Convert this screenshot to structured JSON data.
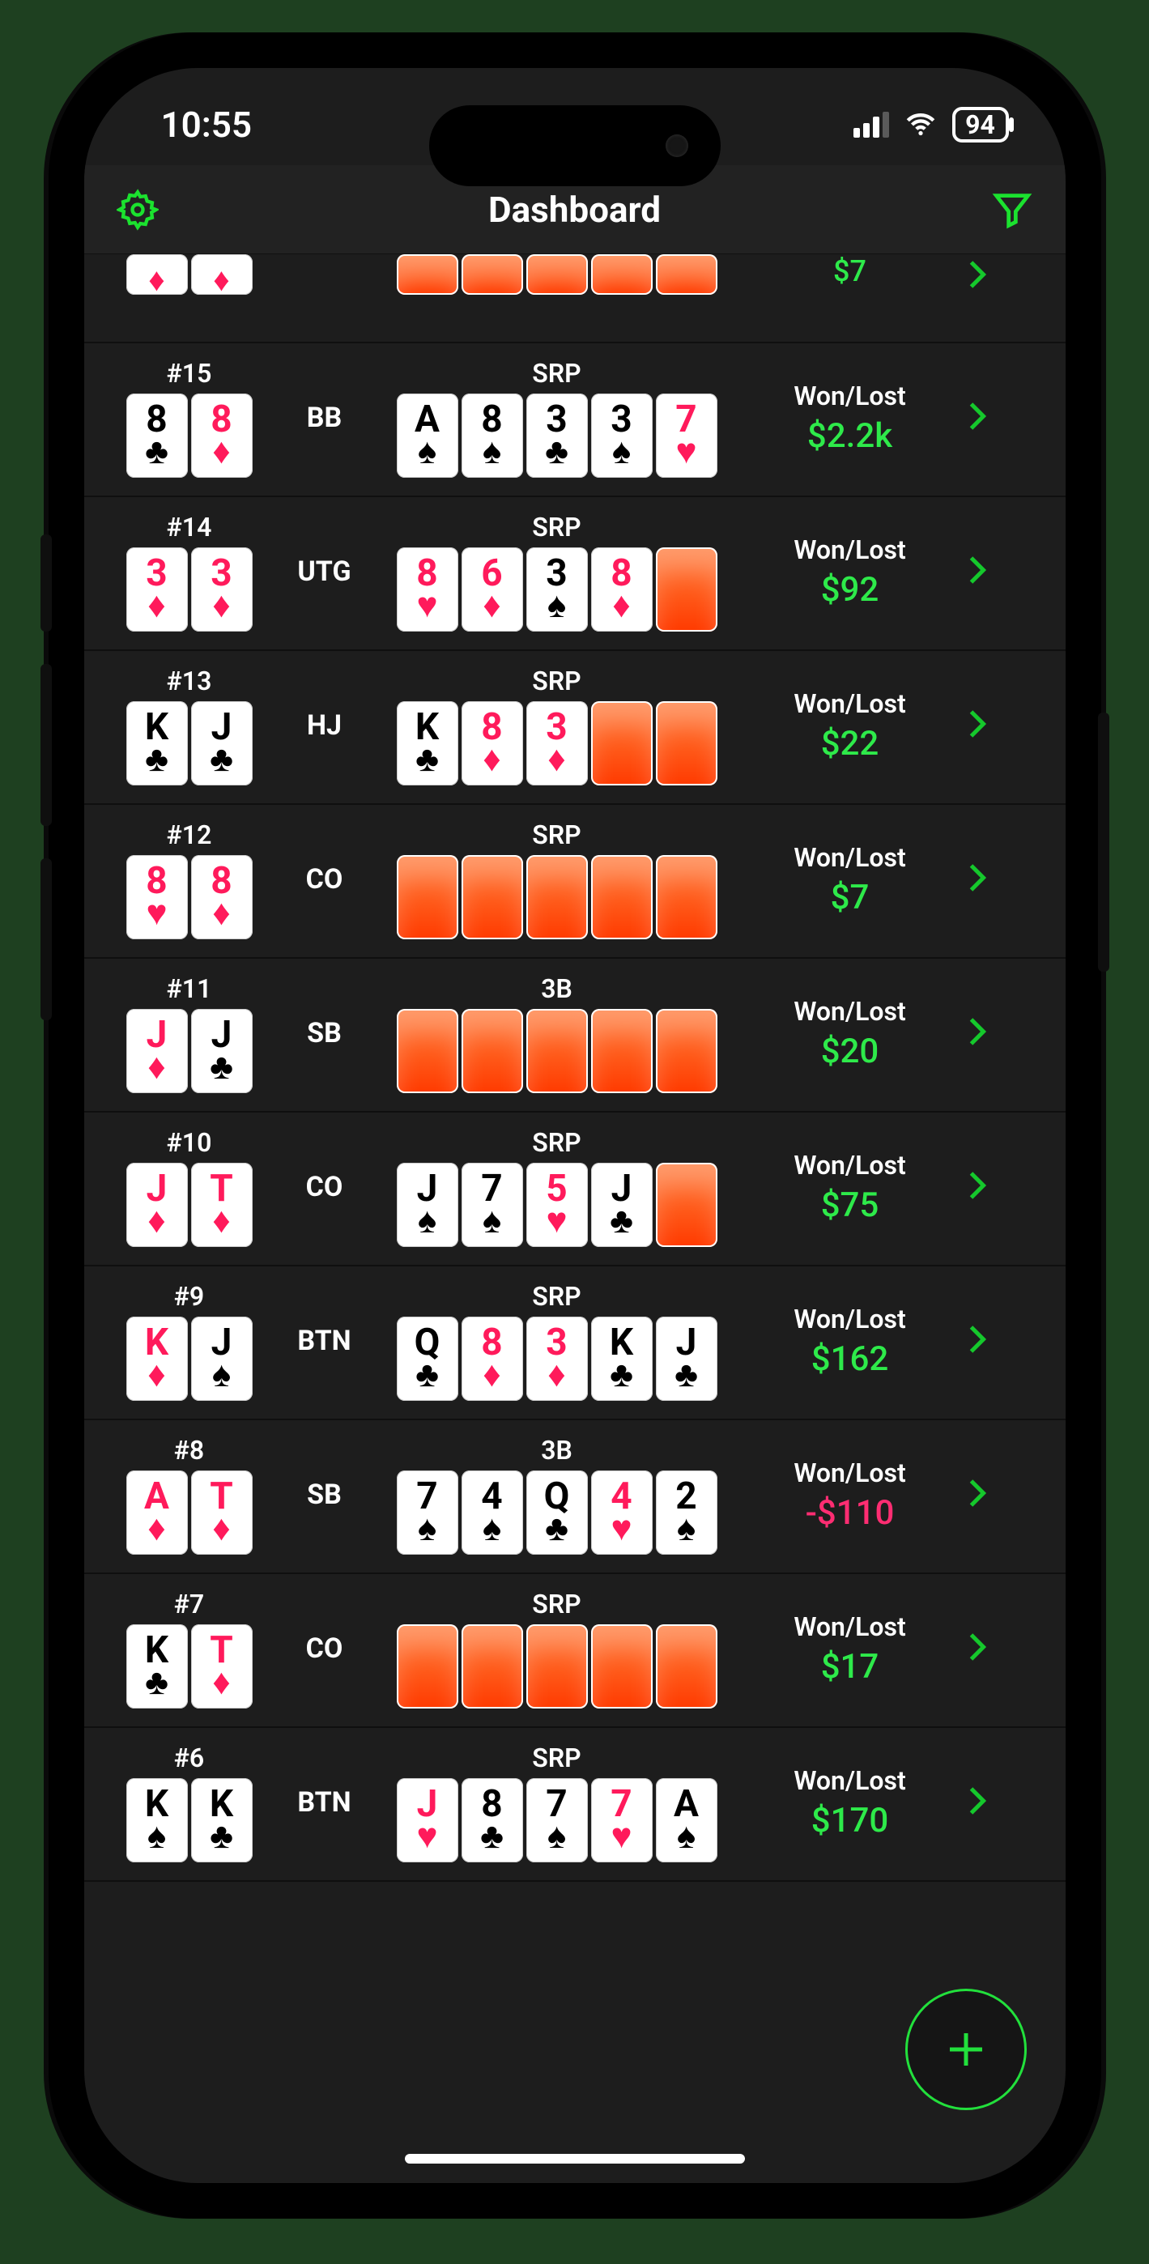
{
  "status": {
    "time": "10:55",
    "battery": "94"
  },
  "nav": {
    "title": "Dashboard"
  },
  "labels": {
    "wonlost": "Won/Lost"
  },
  "colors": {
    "accent": "#22e03c",
    "loss": "#ff2d72"
  },
  "partial_top": {
    "amount": "$7"
  },
  "hands": [
    {
      "num": "#15",
      "position": "BB",
      "pot": "SRP",
      "hole": [
        {
          "r": "8",
          "s": "club"
        },
        {
          "r": "8",
          "s": "diamond"
        }
      ],
      "board": [
        {
          "r": "A",
          "s": "spade"
        },
        {
          "r": "8",
          "s": "spade"
        },
        {
          "r": "3",
          "s": "club"
        },
        {
          "r": "3",
          "s": "spade"
        },
        {
          "r": "7",
          "s": "heart"
        }
      ],
      "amount": "$2.2k",
      "sign": "pos"
    },
    {
      "num": "#14",
      "position": "UTG",
      "pot": "SRP",
      "hole": [
        {
          "r": "3",
          "s": "diamond"
        },
        {
          "r": "3",
          "s": "diamond"
        }
      ],
      "board": [
        {
          "r": "8",
          "s": "heart"
        },
        {
          "r": "6",
          "s": "diamond"
        },
        {
          "r": "3",
          "s": "spade"
        },
        {
          "r": "8",
          "s": "diamond"
        },
        {
          "back": true
        }
      ],
      "amount": "$92",
      "sign": "pos"
    },
    {
      "num": "#13",
      "position": "HJ",
      "pot": "SRP",
      "hole": [
        {
          "r": "K",
          "s": "club"
        },
        {
          "r": "J",
          "s": "club"
        }
      ],
      "board": [
        {
          "r": "K",
          "s": "club"
        },
        {
          "r": "8",
          "s": "diamond"
        },
        {
          "r": "3",
          "s": "diamond"
        },
        {
          "back": true
        },
        {
          "back": true
        }
      ],
      "amount": "$22",
      "sign": "pos"
    },
    {
      "num": "#12",
      "position": "CO",
      "pot": "SRP",
      "hole": [
        {
          "r": "8",
          "s": "heart"
        },
        {
          "r": "8",
          "s": "diamond"
        }
      ],
      "board": [
        {
          "back": true
        },
        {
          "back": true
        },
        {
          "back": true
        },
        {
          "back": true
        },
        {
          "back": true
        }
      ],
      "amount": "$7",
      "sign": "pos"
    },
    {
      "num": "#11",
      "position": "SB",
      "pot": "3B",
      "hole": [
        {
          "r": "J",
          "s": "diamond"
        },
        {
          "r": "J",
          "s": "club"
        }
      ],
      "board": [
        {
          "back": true
        },
        {
          "back": true
        },
        {
          "back": true
        },
        {
          "back": true
        },
        {
          "back": true
        }
      ],
      "amount": "$20",
      "sign": "pos"
    },
    {
      "num": "#10",
      "position": "CO",
      "pot": "SRP",
      "hole": [
        {
          "r": "J",
          "s": "diamond"
        },
        {
          "r": "T",
          "s": "diamond"
        }
      ],
      "board": [
        {
          "r": "J",
          "s": "spade"
        },
        {
          "r": "7",
          "s": "spade"
        },
        {
          "r": "5",
          "s": "heart"
        },
        {
          "r": "J",
          "s": "club"
        },
        {
          "back": true
        }
      ],
      "amount": "$75",
      "sign": "pos"
    },
    {
      "num": "#9",
      "position": "BTN",
      "pot": "SRP",
      "hole": [
        {
          "r": "K",
          "s": "diamond"
        },
        {
          "r": "J",
          "s": "spade"
        }
      ],
      "board": [
        {
          "r": "Q",
          "s": "club"
        },
        {
          "r": "8",
          "s": "diamond"
        },
        {
          "r": "3",
          "s": "diamond"
        },
        {
          "r": "K",
          "s": "club"
        },
        {
          "r": "J",
          "s": "club"
        }
      ],
      "amount": "$162",
      "sign": "pos"
    },
    {
      "num": "#8",
      "position": "SB",
      "pot": "3B",
      "hole": [
        {
          "r": "A",
          "s": "diamond"
        },
        {
          "r": "T",
          "s": "diamond"
        }
      ],
      "board": [
        {
          "r": "7",
          "s": "spade"
        },
        {
          "r": "4",
          "s": "spade"
        },
        {
          "r": "Q",
          "s": "club"
        },
        {
          "r": "4",
          "s": "heart"
        },
        {
          "r": "2",
          "s": "spade"
        }
      ],
      "amount": "-$110",
      "sign": "neg"
    },
    {
      "num": "#7",
      "position": "CO",
      "pot": "SRP",
      "hole": [
        {
          "r": "K",
          "s": "club"
        },
        {
          "r": "T",
          "s": "diamond"
        }
      ],
      "board": [
        {
          "back": true
        },
        {
          "back": true
        },
        {
          "back": true
        },
        {
          "back": true
        },
        {
          "back": true
        }
      ],
      "amount": "$17",
      "sign": "pos"
    },
    {
      "num": "#6",
      "position": "BTN",
      "pot": "SRP",
      "hole": [
        {
          "r": "K",
          "s": "spade"
        },
        {
          "r": "K",
          "s": "club"
        }
      ],
      "board": [
        {
          "r": "J",
          "s": "heart"
        },
        {
          "r": "8",
          "s": "club"
        },
        {
          "r": "7",
          "s": "spade"
        },
        {
          "r": "7",
          "s": "heart"
        },
        {
          "r": "A",
          "s": "spade"
        }
      ],
      "amount": "$170",
      "sign": "pos"
    }
  ]
}
